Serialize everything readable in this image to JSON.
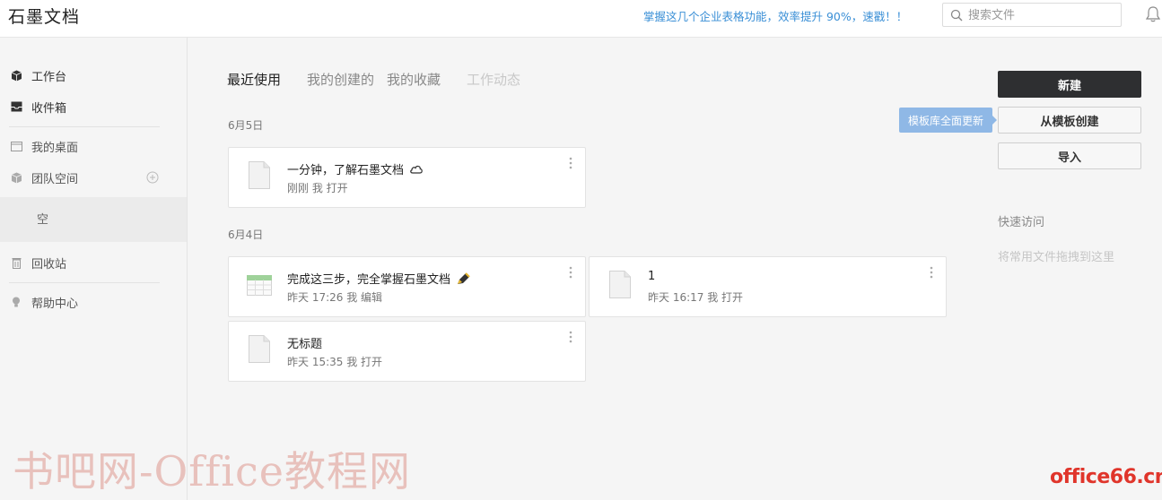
{
  "app": {
    "logo": "石墨文档"
  },
  "header": {
    "promo": "掌握这几个企业表格功能，效率提升 90%，速戳！！",
    "search_placeholder": "搜索文件"
  },
  "sidebar": {
    "workbench": "工作台",
    "inbox": "收件箱",
    "desktop": "我的桌面",
    "team_space": "团队空间",
    "empty": "空",
    "trash": "回收站",
    "help": "帮助中心"
  },
  "tabs": {
    "recent": "最近使用",
    "created": "我的创建的",
    "favorites": "我的收藏",
    "activity": "工作动态"
  },
  "groups": [
    {
      "date": "6月5日",
      "files": [
        {
          "title": "一分钟，了解石墨文档",
          "meta": "刚刚 我 打开",
          "icon": "doc-icon",
          "badge": "cloud-icon"
        }
      ]
    },
    {
      "date": "6月4日",
      "files": [
        {
          "title": "完成这三步，完全掌握石墨文档",
          "meta": "昨天 17:26 我 编辑",
          "icon": "sheet-icon",
          "badge": "pencil-icon"
        },
        {
          "title": "1",
          "meta": "昨天 16:17 我 打开",
          "icon": "doc-icon"
        },
        {
          "title": "无标题",
          "meta": "昨天 15:35 我 打开",
          "icon": "doc-icon"
        }
      ]
    }
  ],
  "actions": {
    "new": "新建",
    "from_template": "从模板创建",
    "import": "导入",
    "template_tip": "模板库全面更新"
  },
  "quick_access": {
    "title": "快速访问",
    "hint": "将常用文件拖拽到这里"
  },
  "watermarks": {
    "left": "书吧网-Office教程网",
    "right": "office66.cn"
  },
  "colors": {
    "accent": "#3a8fd6",
    "primary_button": "#2e2f31",
    "tip": "#8fb8e6",
    "watermark_right": "#e0352b"
  }
}
